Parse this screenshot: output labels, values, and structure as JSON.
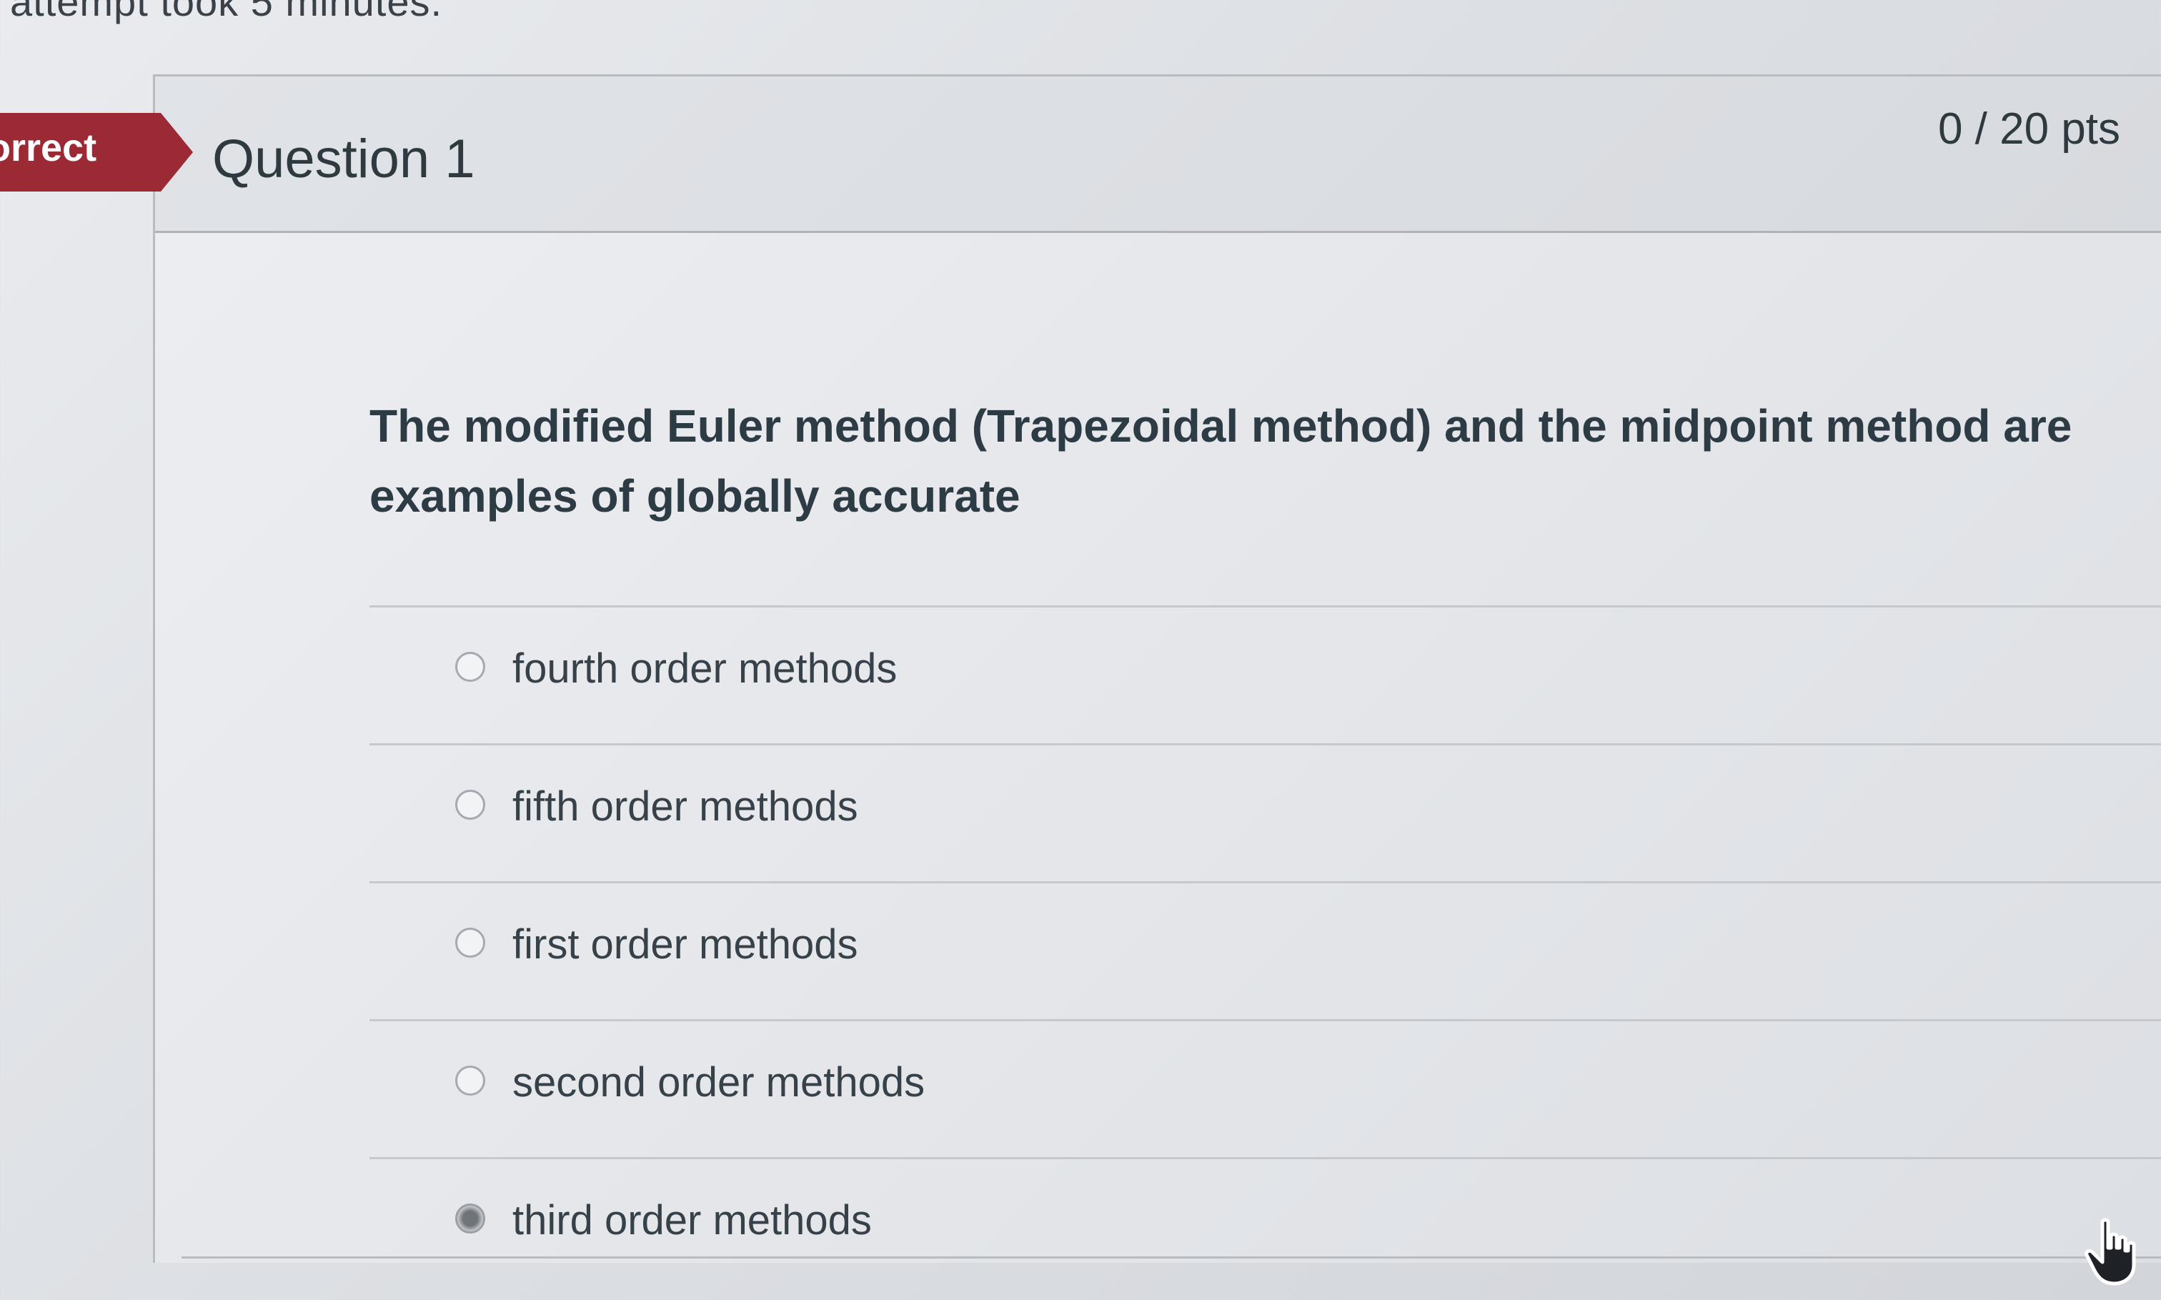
{
  "attempt_note": "attempt took 5 minutes.",
  "question": {
    "status_label": "orrect",
    "title": "Question 1",
    "points": "0 / 20 pts",
    "prompt": "The modified Euler method (Trapezoidal method) and the midpoint method are examples of globally accurate",
    "answers": [
      {
        "label": "fourth order methods",
        "selected": false
      },
      {
        "label": "fifth order methods",
        "selected": false
      },
      {
        "label": "first order methods",
        "selected": false
      },
      {
        "label": "second order methods",
        "selected": false
      },
      {
        "label": "third order methods",
        "selected": true
      }
    ]
  },
  "colors": {
    "incorrect_flag": "#9b2a35",
    "text": "#2d3b45"
  },
  "icons": {
    "cursor": "hand-pointer-icon",
    "radio": "radio-button-icon"
  }
}
